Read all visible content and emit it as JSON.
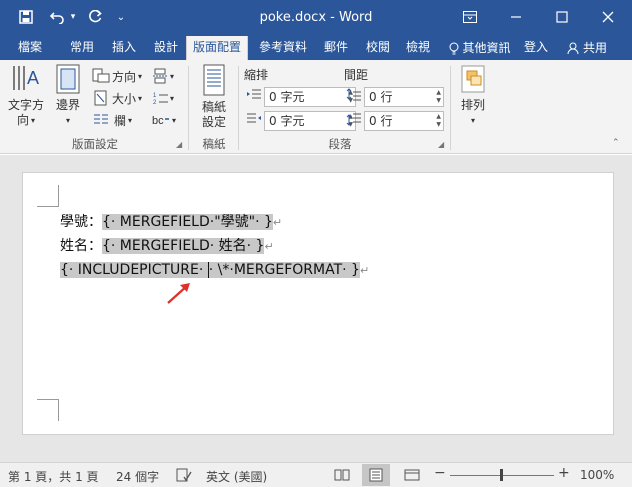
{
  "titlebar": {
    "title": "poke.docx - Word",
    "undo_dropdown": "▾",
    "customize": "⌄"
  },
  "tabs": [
    {
      "label": "檔案",
      "active": false
    },
    {
      "label": "常用",
      "active": false
    },
    {
      "label": "插入",
      "active": false
    },
    {
      "label": "設計",
      "active": false
    },
    {
      "label": "版面配置",
      "active": true
    },
    {
      "label": "參考資料",
      "active": false
    },
    {
      "label": "郵件",
      "active": false
    },
    {
      "label": "校閱",
      "active": false
    },
    {
      "label": "檢視",
      "active": false
    }
  ],
  "tellme": "其他資訊",
  "signin": "登入",
  "share": "共用",
  "ribbon": {
    "text_direction": [
      "文字方",
      "向"
    ],
    "margins": "邊界",
    "orientation": "方向",
    "size": "大小",
    "columns": "欄",
    "page_setup_label": "版面設定",
    "watermark": [
      "稿紙",
      "設定"
    ],
    "watermark_group": "稿紙",
    "indent_label": "縮排",
    "spacing_label": "間距",
    "indent_left": "0 字元",
    "indent_right": "0 字元",
    "spacing_before": "0 行",
    "spacing_after": "0 行",
    "paragraph_label": "段落",
    "arrange": "排列"
  },
  "document": {
    "line1_label": "學號：",
    "line1_field": "{· MERGEFIELD·\"學號\"· }",
    "line2_label": "姓名：",
    "line2_field": "{· MERGEFIELD· 姓名· }",
    "line3_field_a": "{· INCLUDEPICTURE· ",
    "line3_field_b": "· \\*·MERGEFORMAT· }",
    "para_mark": "↵"
  },
  "status": {
    "page": "第 1 頁，共 1 頁",
    "words": "24 個字",
    "language": "英文 (美國)",
    "zoom": "100%",
    "minus": "−",
    "plus": "+"
  },
  "colors": {
    "accent": "#2b579a",
    "ribbon_bg": "#f3f3f3",
    "field_shade": "#c8c8c8",
    "arrow": "#e0302a"
  }
}
